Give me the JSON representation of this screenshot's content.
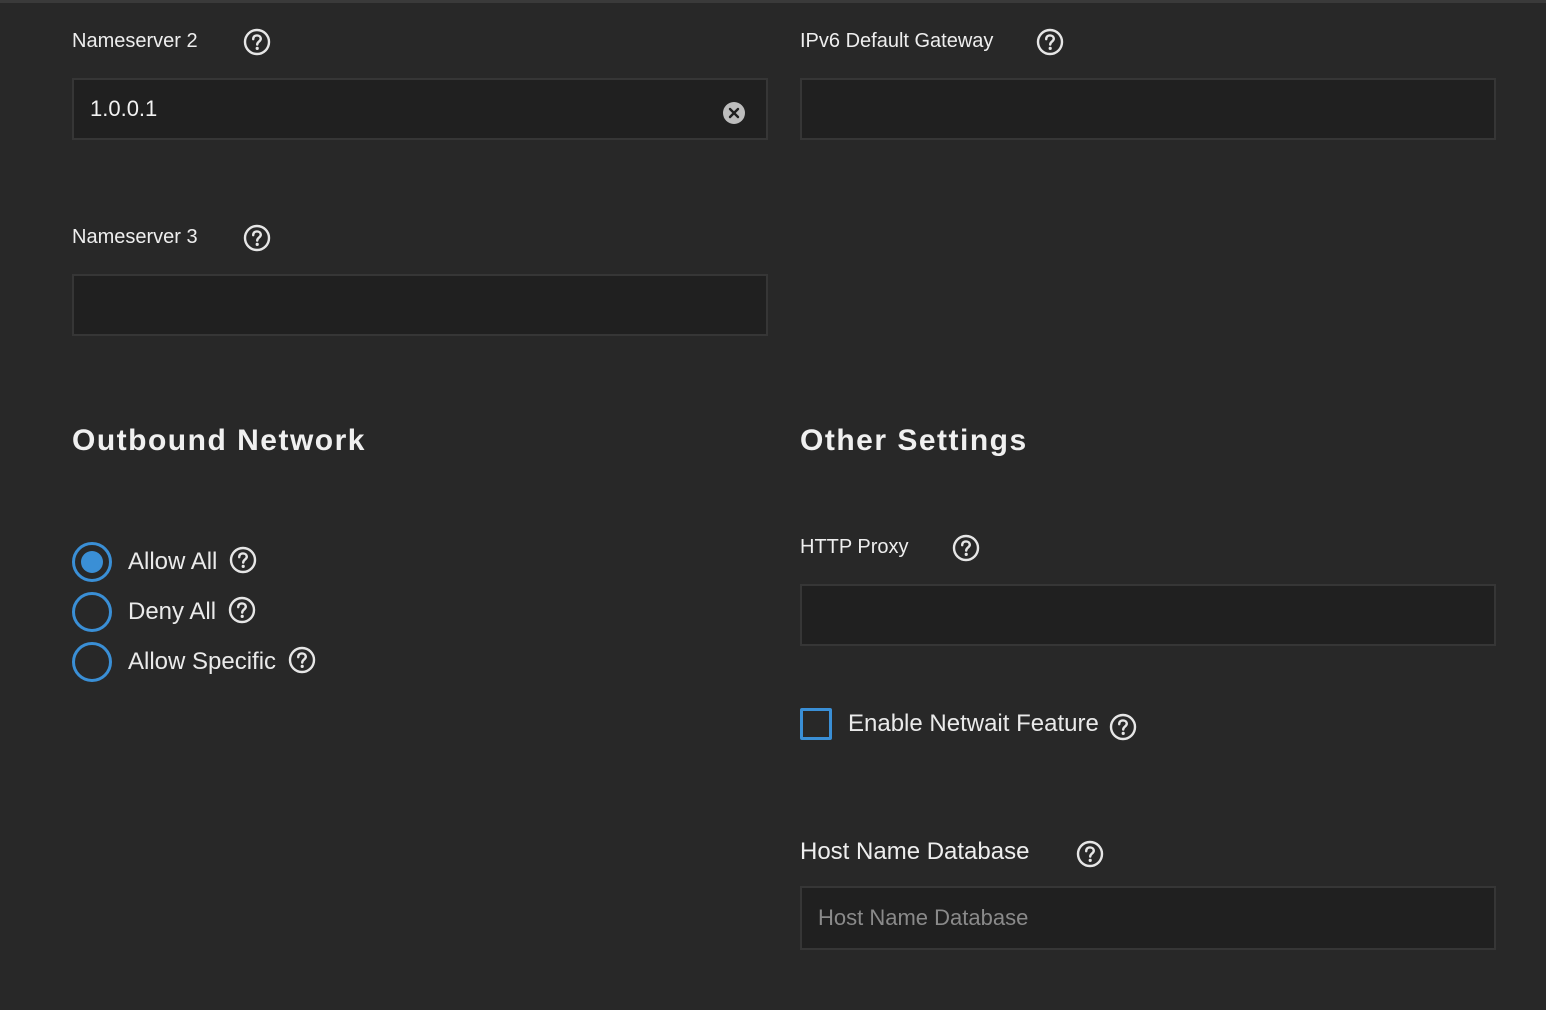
{
  "nameserver2": {
    "label": "Nameserver 2",
    "value": "1.0.0.1"
  },
  "ipv6_gateway": {
    "label": "IPv6 Default Gateway",
    "value": ""
  },
  "nameserver3": {
    "label": "Nameserver 3",
    "value": ""
  },
  "outbound": {
    "title": "Outbound Network",
    "options": [
      {
        "label": "Allow All",
        "checked": true
      },
      {
        "label": "Deny All",
        "checked": false
      },
      {
        "label": "Allow Specific",
        "checked": false
      }
    ]
  },
  "other": {
    "title": "Other Settings",
    "http_proxy": {
      "label": "HTTP Proxy",
      "value": ""
    },
    "netwait": {
      "label": "Enable Netwait Feature",
      "checked": false
    },
    "host_db": {
      "label": "Host Name Database",
      "placeholder": "Host Name Database",
      "value": ""
    }
  },
  "colors": {
    "background": "#282828",
    "input_bg": "#202020",
    "accent": "#3a8fd6"
  },
  "icons": {
    "help": "help-circle-icon",
    "clear": "clear-circle-icon"
  }
}
